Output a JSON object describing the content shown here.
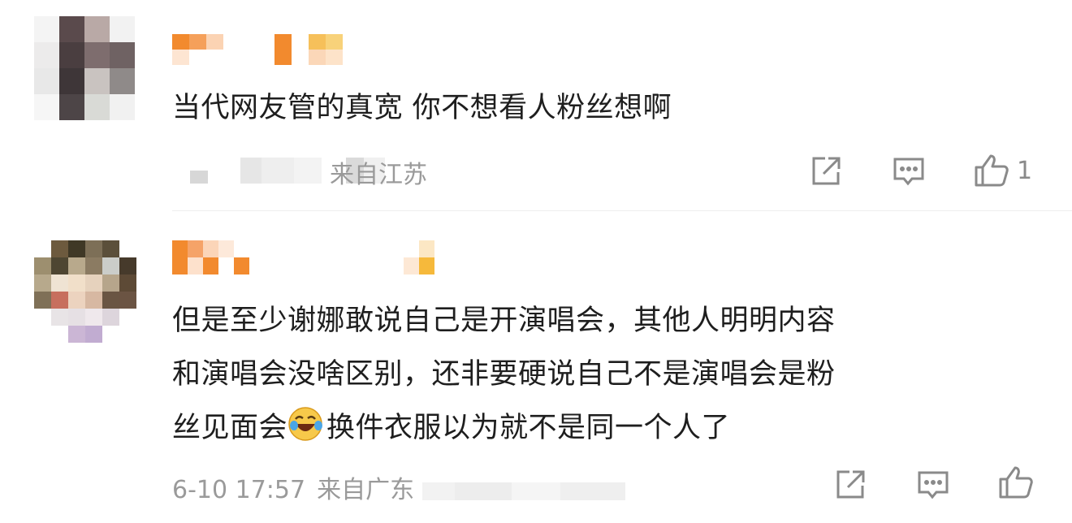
{
  "comments": [
    {
      "text": "当代网友管的真宽 你不想看人粉丝想啊",
      "meta_time": "",
      "meta_location": "来自江苏",
      "like_count": "1",
      "icons": [
        "share-icon",
        "comment-icon",
        "like-icon"
      ]
    },
    {
      "text_line1": "但是至少谢娜敢说自己是开演唱会，其他人明明内容",
      "text_line2": "和演唱会没啥区别，还非要硬说自己不是演唱会是粉",
      "text_line3a": "丝见面会",
      "text_line3b": "换件衣服以为就不是同一个人了",
      "emoji": "laughing-crying-emoji",
      "meta_time": "6-10 17:57",
      "meta_location": "来自广东",
      "icons": [
        "share-icon",
        "comment-icon",
        "like-icon"
      ]
    }
  ],
  "colors": {
    "name_orange": "#f28a2e",
    "name_yellow": "#f6b93b",
    "text": "#1e1e1e",
    "meta": "#9a9a9a",
    "icon": "#8a8a8a"
  }
}
